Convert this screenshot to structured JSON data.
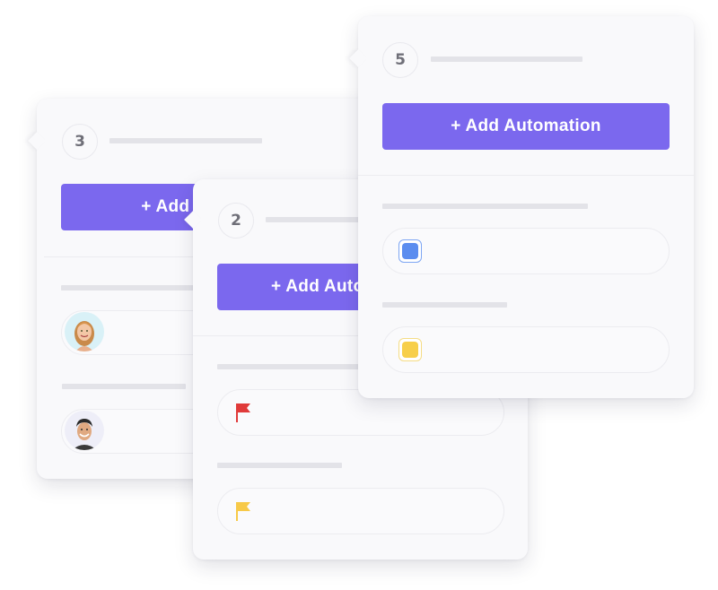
{
  "cards": [
    {
      "step": "3",
      "button_label": "+ Add Automation",
      "items": [
        {
          "type": "avatar",
          "icon": "woman-avatar"
        },
        {
          "type": "avatar",
          "icon": "man-avatar"
        }
      ]
    },
    {
      "step": "2",
      "button_label": "+ Add Automation",
      "items": [
        {
          "type": "flag",
          "icon": "flag-icon",
          "color": "#e03a3a"
        },
        {
          "type": "flag",
          "icon": "flag-icon",
          "color": "#f7c948"
        }
      ]
    },
    {
      "step": "5",
      "button_label": "+ Add Automation",
      "items": [
        {
          "type": "status",
          "icon": "status-square-icon",
          "color": "#5b8def"
        },
        {
          "type": "status",
          "icon": "status-square-icon",
          "color": "#f7cf4a"
        }
      ]
    }
  ],
  "colors": {
    "accent": "#7b68ee",
    "placeholder_bar": "#e3e3e8"
  }
}
